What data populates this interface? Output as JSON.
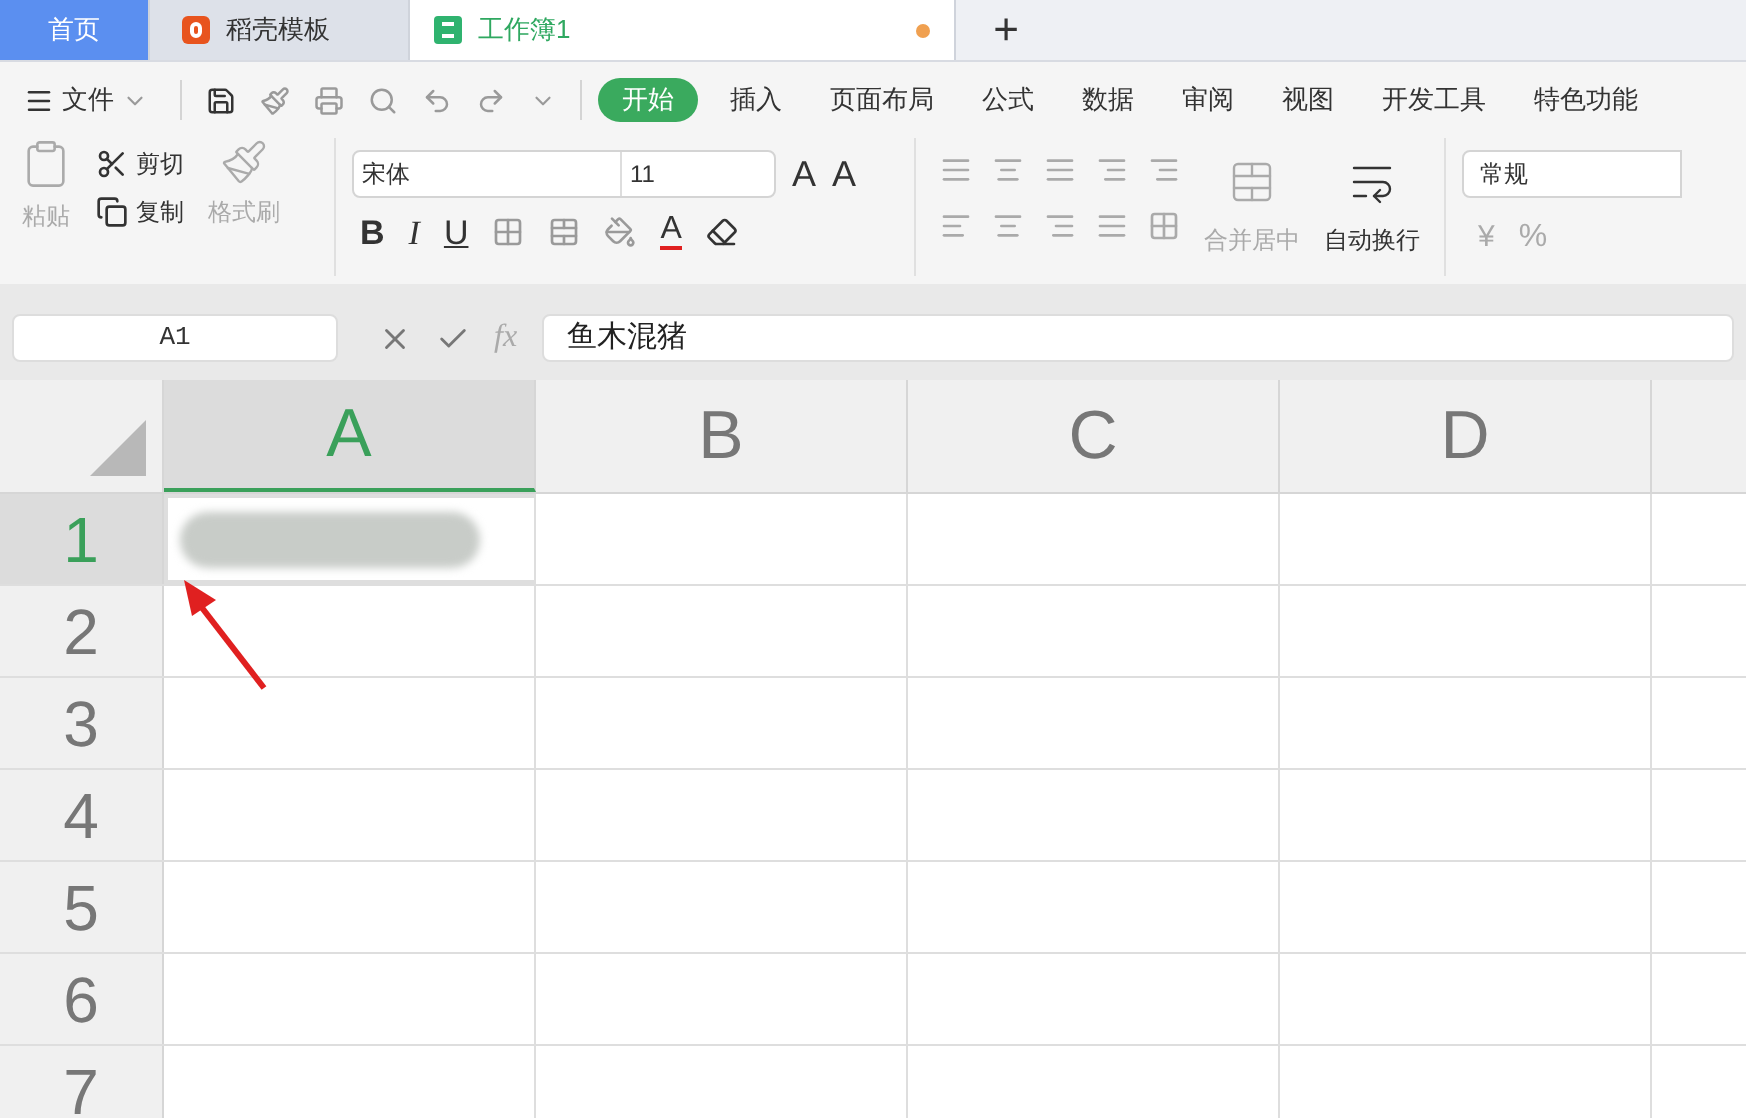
{
  "tabs": [
    {
      "kind": "home",
      "label": "首页",
      "selected": false
    },
    {
      "kind": "template",
      "label": "稻壳模板",
      "selected": false
    },
    {
      "kind": "workbook",
      "label": "工作簿1",
      "selected": true,
      "modified": true
    }
  ],
  "new_tab": "+",
  "file_menu": "文件",
  "menu": [
    {
      "label": "开始",
      "selected": true
    },
    {
      "label": "插入",
      "selected": false
    },
    {
      "label": "页面布局",
      "selected": false
    },
    {
      "label": "公式",
      "selected": false
    },
    {
      "label": "数据",
      "selected": false
    },
    {
      "label": "审阅",
      "selected": false
    },
    {
      "label": "视图",
      "selected": false
    },
    {
      "label": "开发工具",
      "selected": false
    },
    {
      "label": "特色功能",
      "selected": false
    }
  ],
  "clipboard": {
    "paste": "粘贴",
    "cut": "剪切",
    "copy": "复制",
    "format_painter": "格式刷"
  },
  "font": {
    "name": "宋体",
    "size": "11",
    "styles": [
      "B",
      "I",
      "U"
    ],
    "size_buttons": [
      "A",
      "A"
    ],
    "color_button": "A"
  },
  "alignment": {
    "merge": "合并居中",
    "wrap": "自动换行"
  },
  "number": {
    "format": "常规",
    "currency": "¥",
    "percent": "%"
  },
  "formula_bar": {
    "cell_ref": "A1",
    "function": "fx",
    "value": "鱼木混猪"
  },
  "grid": {
    "columns": [
      {
        "label": "A",
        "selected": true
      },
      {
        "label": "B",
        "selected": false
      },
      {
        "label": "C",
        "selected": false
      },
      {
        "label": "D",
        "selected": false
      }
    ],
    "rows": [
      {
        "label": "1",
        "selected": true
      },
      {
        "label": "2",
        "selected": false
      },
      {
        "label": "3",
        "selected": false
      },
      {
        "label": "4",
        "selected": false
      },
      {
        "label": "5",
        "selected": false
      },
      {
        "label": "6",
        "selected": false
      },
      {
        "label": "7",
        "selected": false
      }
    ]
  }
}
